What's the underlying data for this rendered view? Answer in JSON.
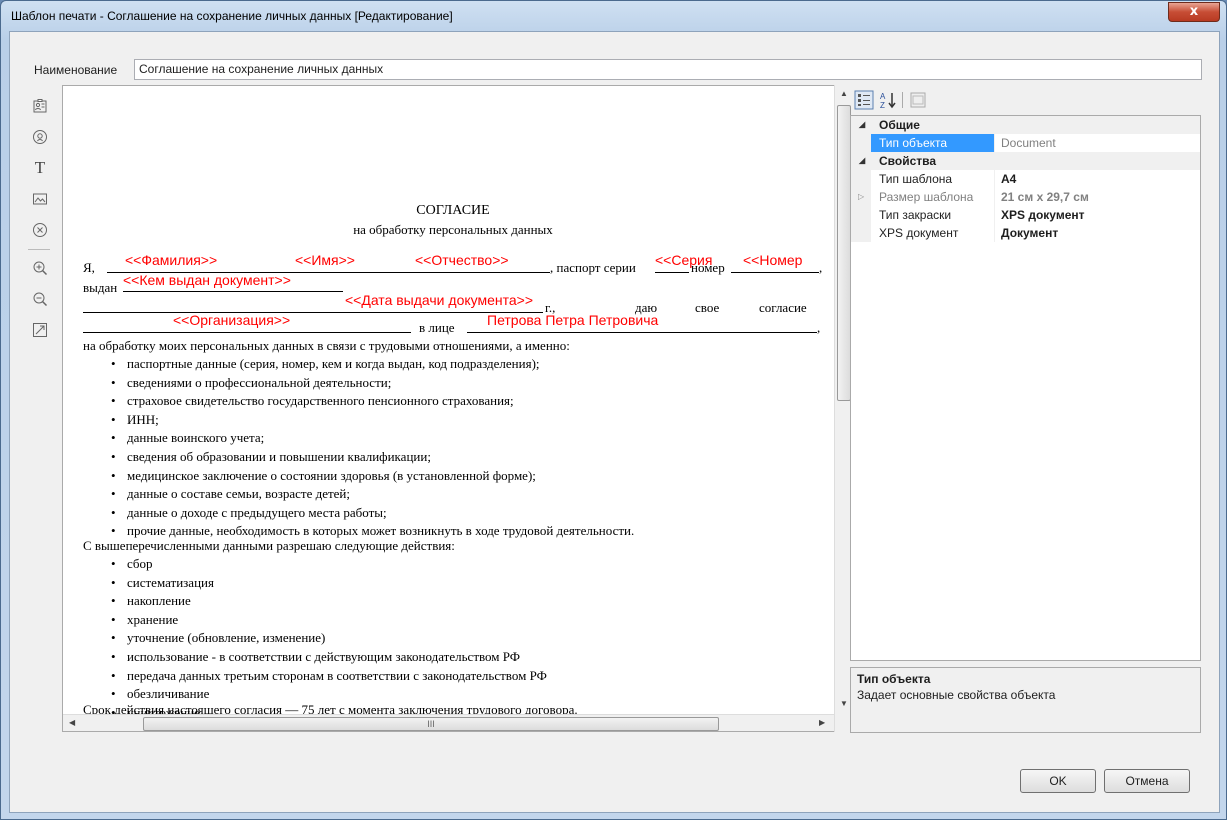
{
  "window": {
    "title": "Шаблон печати - Соглашение на сохранение личных данных [Редактирование]",
    "close_glyph": "x"
  },
  "form": {
    "name_label": "Наименование",
    "name_value": "Соглашение на сохранение личных данных"
  },
  "left_toolbar": {
    "icons": [
      "contact-card-icon",
      "at-sign-icon",
      "text-icon",
      "image-icon",
      "remove-icon",
      "zoom-in-icon",
      "zoom-out-icon",
      "fit-page-icon"
    ],
    "text_tool_glyph": "T"
  },
  "document": {
    "title": "СОГЛАСИЕ",
    "subtitle": "на обработку персональных данных",
    "line1_prefix": "Я,",
    "line1_passport": ", паспорт серии",
    "line1_number": "номер",
    "line2_issued": "выдан",
    "line3_year": "г.,",
    "line3_give": "даю",
    "line3_own": "свое",
    "line3_consent": "согласие",
    "line4_face": "в лице",
    "line5": "на обработку моих персональных данных в связи с трудовыми отношениями, а именно:",
    "fields": {
      "surname": "<<Фамилия>>",
      "name": "<<Имя>>",
      "patronymic": "<<Отчество>>",
      "series": "<<Серия",
      "number": "<<Номер",
      "issued_by": "<<Кем выдан документ>>",
      "issue_date": "<<Дата выдачи документа>>",
      "organization": "<<Организация>>",
      "representative": "Петрова Петра Петровича"
    },
    "data_list": [
      "паспортные данные (серия, номер, кем и когда выдан, код подразделения);",
      "сведениями о профессиональной деятельности;",
      "страховое свидетельство государственного пенсионного страхования;",
      "ИНН;",
      "данные воинского учета;",
      "сведения об образовании и повышении квалификации;",
      "медицинское заключение о состоянии здоровья (в установленной форме);",
      "данные о составе семьи, возрасте детей;",
      "данные о доходе с предыдущего места работы;",
      "прочие данные, необходимость в которых может возникнуть в ходе трудовой деятельности."
    ],
    "actions_intro": "С вышеперечисленными данными разрешаю следующие действия:",
    "actions_list": [
      "сбор",
      "систематизация",
      "накопление",
      "хранение",
      "уточнение (обновление, изменение)",
      "использование - в соответствии с действующим законодательством РФ",
      "передача данных третьим сторонам в соответствии с законодательством РФ",
      "обезличивание",
      "уничтожение"
    ],
    "term": "Срок действия настоящего согласия — 75 лет с момента заключения трудового договора."
  },
  "scrollbar": {
    "grip": "III"
  },
  "properties": {
    "toolbar_icons": [
      "categorized-icon",
      "sort-az-icon",
      "property-pages-icon"
    ],
    "categories": [
      {
        "name": "Общие",
        "rows": [
          {
            "name": "Тип объекта",
            "value": "Document",
            "selected": true
          }
        ]
      },
      {
        "name": "Свойства",
        "rows": [
          {
            "name": "Тип шаблона",
            "value": "A4"
          },
          {
            "name": "Размер шаблона",
            "value": "21 см x 29,7 см",
            "disabled": true
          },
          {
            "name": "Тип закраски",
            "value": "XPS документ"
          },
          {
            "name": "XPS документ",
            "value": "Документ"
          }
        ]
      }
    ],
    "description": {
      "title": "Тип объекта",
      "text": "Задает основные свойства объекта"
    }
  },
  "buttons": {
    "ok": "OK",
    "cancel": "Отмена"
  }
}
